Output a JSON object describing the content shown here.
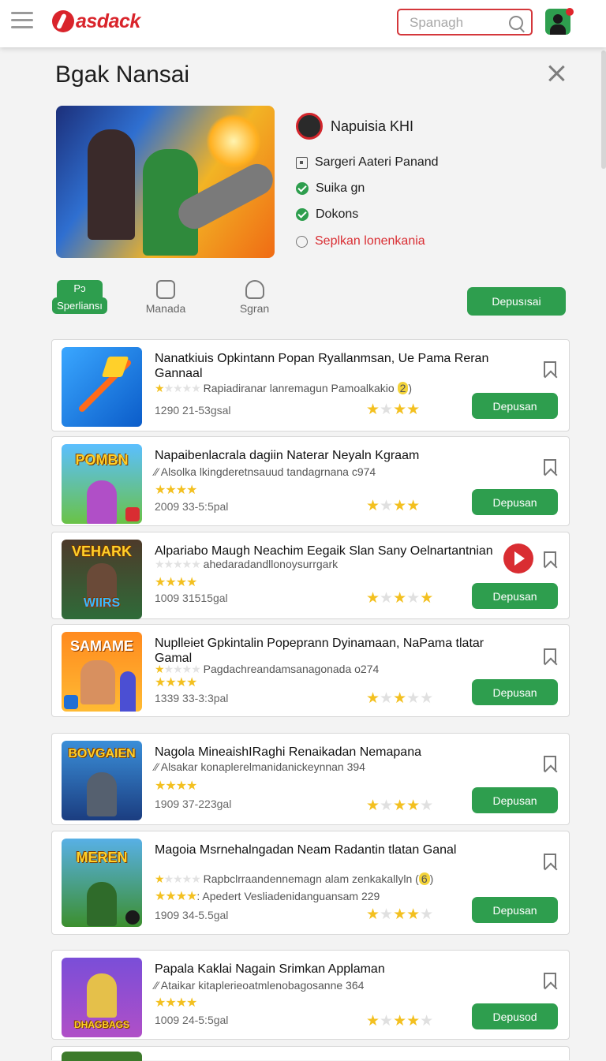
{
  "header": {
    "logo_text": "asdack",
    "search_placeholder": "Spanagh"
  },
  "dialog": {
    "title": "Bgak Nansai",
    "creator": "Napuisia KHI",
    "info": [
      {
        "icon": "box-icon",
        "text": "Sargeri Aateri Panand"
      },
      {
        "icon": "check-icon",
        "text": "Suika gn"
      },
      {
        "icon": "check-icon",
        "text": "Dokons"
      },
      {
        "icon": "ring-icon",
        "text": "Seplkan lonenkania"
      }
    ],
    "tabs": [
      {
        "icon_text": "Pɔ",
        "label": "Sperliansı"
      },
      {
        "label": "Manada"
      },
      {
        "label": "Sgran"
      }
    ],
    "primary_button": "Depusısai"
  },
  "games": [
    {
      "title": "Nanatkiuis Opkintann Popan Ryallanmsan, Ue Pama Reran Gannaal",
      "subtitle": "Rapiadiranar lanremagun Pamoalkakio",
      "badge": "2",
      "meta": "1290 21-53gsal",
      "button": "Depusan",
      "rating": 4
    },
    {
      "title": "Napaibenlacrala dagiin Naterar Neyaln Kgraam",
      "subtitle": "Alsolka lkingderetnsauud tandagrnana c974",
      "meta": "2009 33-5:5pal",
      "button": "Depusan",
      "rating": 4
    },
    {
      "title": "Alpariabo Maugh Neachim Eegaik Slan Sany Oelnartantnian",
      "subtitle": "ahedaradandllonoysurrgark",
      "meta": "1009 31515gal",
      "button": "Depusan",
      "rating": 3
    },
    {
      "title": "Nuplleiet Gpkintalin Popeprann Dyinamaan, NaPama tlatar Gamal",
      "subtitle": "Pagdachreandamsanagonada o274",
      "meta": "1339 33-3:3pal",
      "button": "Depusan",
      "rating": 2
    },
    {
      "title": "Nagola MineaishIRaghi Renaikadan Nemapana",
      "subtitle": "Alsakar konaplerelmanidanickeynnan 394",
      "meta": "1909 37-223gal",
      "button": "Depusan",
      "rating": 3
    },
    {
      "title": "Magoia Msrnehalngadan Neam Radantin tlatan Ganal",
      "subtitle": "Rapbclrraandennemagn alam zenkakallyln",
      "badge": "6",
      "subtitle2": "Apedert Vesliadenidanguansam 229",
      "meta": "1909 34-5.5gal",
      "button": "Depusan",
      "rating": 4
    },
    {
      "title": "Papala Kaklai Nagain Srimkan Applaman",
      "subtitle": "Ataikar kitaplerieoatmlenobagosanne 364",
      "meta": "1009 24-5:5gal",
      "button": "Depusod",
      "rating": 3
    }
  ],
  "colors": {
    "brand_red": "#d9242b",
    "accent_green": "#2e9e4e"
  }
}
